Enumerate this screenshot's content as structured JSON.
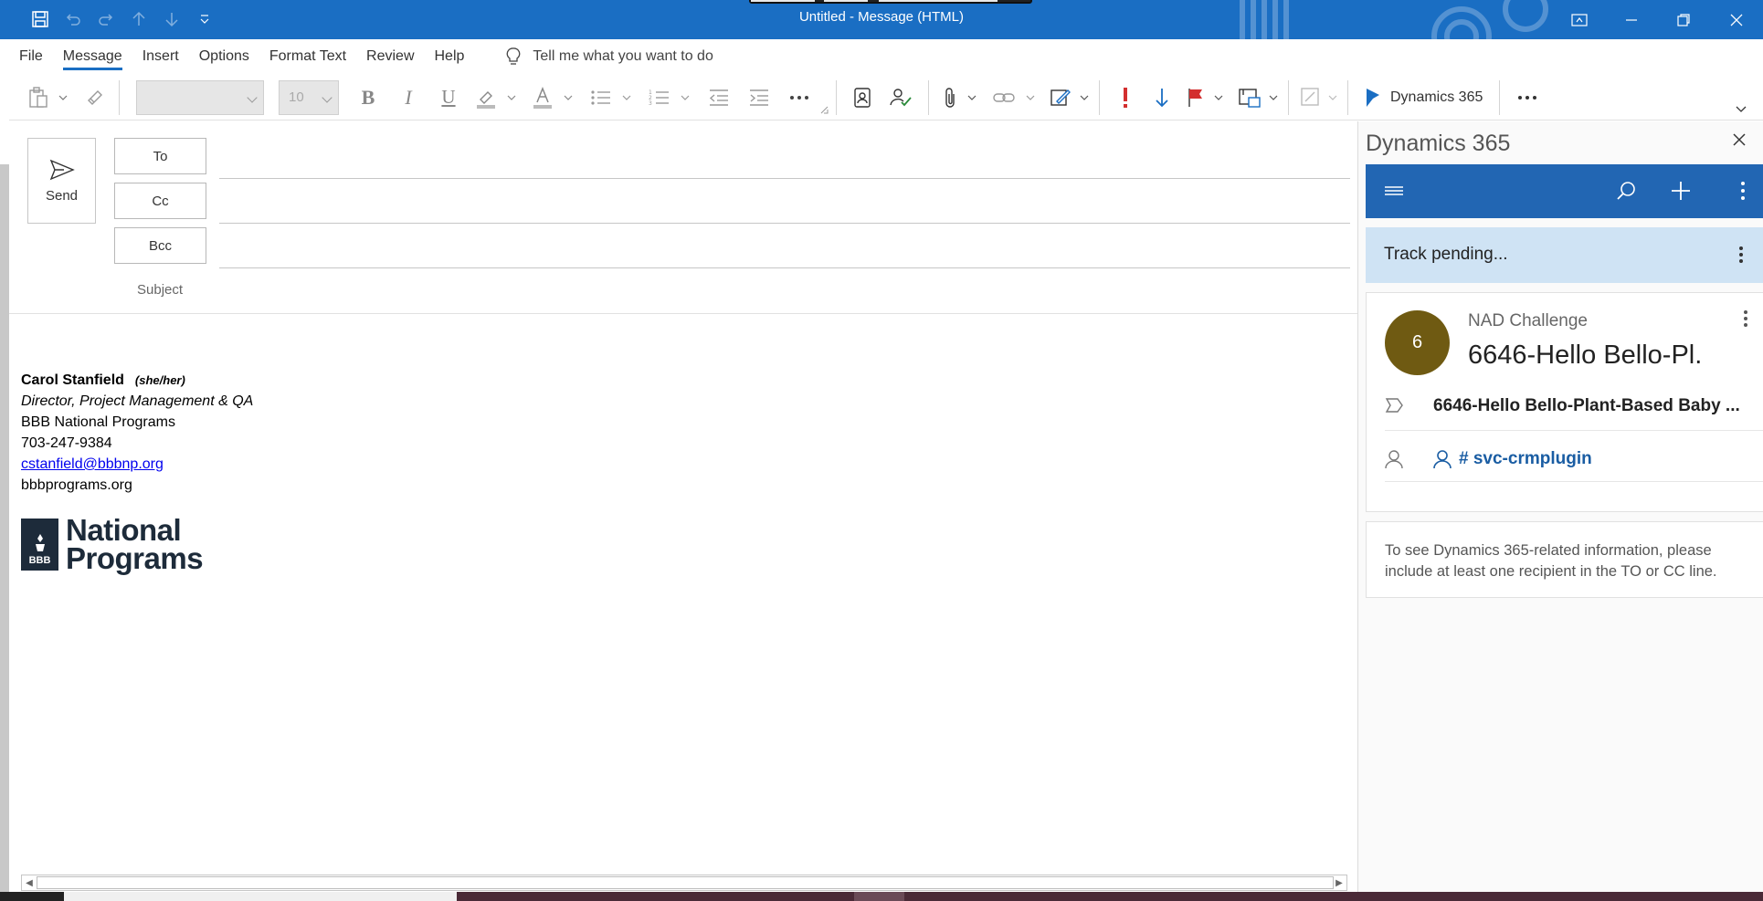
{
  "window": {
    "title": "Untitled  -  Message (HTML)"
  },
  "menu": {
    "tabs": [
      "File",
      "Message",
      "Insert",
      "Options",
      "Format Text",
      "Review",
      "Help"
    ],
    "active": "Message",
    "tell_me": "Tell me what you want to do"
  },
  "ribbon": {
    "font_size": "10",
    "dynamics_label": "Dynamics 365"
  },
  "compose": {
    "send_label": "Send",
    "to_label": "To",
    "cc_label": "Cc",
    "bcc_label": "Bcc",
    "subject_label": "Subject",
    "to_value": "",
    "cc_value": "",
    "bcc_value": "",
    "subject_value": ""
  },
  "signature": {
    "name": "Carol Stanfield",
    "pronouns": "(she/her)",
    "title": "Director, Project Management & QA",
    "org": "BBB National Programs",
    "phone": "703-247-9384",
    "email": "cstanfield@bbbnp.org",
    "website": "bbbprograms.org",
    "logo_seal": "BBB",
    "logo_line1": "National",
    "logo_line2": "Programs"
  },
  "panel": {
    "title": "Dynamics 365",
    "track_status": "Track pending...",
    "record": {
      "avatar_letter": "6",
      "type": "NAD Challenge",
      "name": "6646-Hello Bello-Pl.",
      "regarding": "6646-Hello Bello-Plant-Based Baby ...",
      "owner": "# svc-crmplugin"
    },
    "info_message": "To see Dynamics 365-related information, please include at least one recipient in the TO or CC line."
  },
  "colors": {
    "titlebar": "#1a6ec3",
    "dynamics_bar": "#2266b3",
    "track_bg": "#cfe3f4",
    "avatar": "#6f5a12",
    "link": "#1a5da3"
  }
}
